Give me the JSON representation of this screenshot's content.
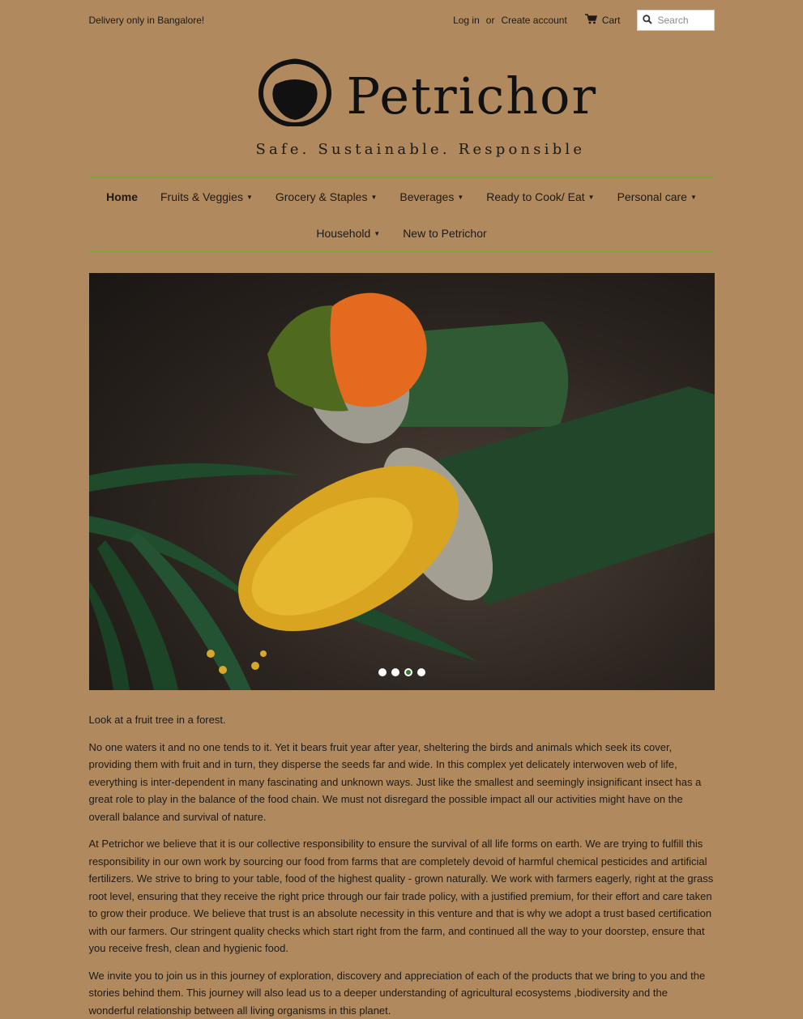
{
  "topbar": {
    "delivery_note": "Delivery only in Bangalore!",
    "login": "Log in",
    "or": "or",
    "create_account": "Create account",
    "cart": "Cart",
    "search_placeholder": "Search"
  },
  "brand": {
    "name": "Petrichor",
    "tagline": "Safe. Sustainable. Responsible"
  },
  "nav": {
    "row1": [
      {
        "label": "Home",
        "active": true,
        "dropdown": false
      },
      {
        "label": "Fruits & Veggies",
        "dropdown": true
      },
      {
        "label": "Grocery & Staples",
        "dropdown": true
      },
      {
        "label": "Beverages",
        "dropdown": true
      },
      {
        "label": "Ready to Cook/ Eat",
        "dropdown": true
      },
      {
        "label": "Personal care",
        "dropdown": true
      }
    ],
    "row2": [
      {
        "label": "Household",
        "dropdown": true
      },
      {
        "label": "New to Petrichor",
        "dropdown": false
      }
    ],
    "caret": "▼"
  },
  "slideshow": {
    "slide_count": 4,
    "active_index": 2
  },
  "content": {
    "p1": "Look at a fruit tree in a forest.",
    "p2": "No one waters it and no one tends to it. Yet it bears fruit year after year, sheltering the birds and animals which seek its cover, providing them with fruit and in turn, they disperse the seeds far and wide. In this complex yet delicately interwoven web of life, everything is inter-dependent in many fascinating and unknown ways.  Just like the smallest and seemingly insignificant insect has a great role to play in the balance of the food chain. We must not disregard the possible impact all our activities might have on the overall balance and survival of nature.",
    "p3": "At Petrichor we believe that it is our collective responsibility to ensure the survival of all life forms on earth. We are trying to fulfill this responsibility in our own work by sourcing our food from farms that are completely devoid of harmful chemical pesticides and artificial fertilizers.  We strive to bring to your table, food of the highest quality - grown naturally. We work with farmers eagerly, right at the grass root level, ensuring that they receive the right price through our fair trade policy, with a justified premium, for their effort and care taken to grow their produce. We believe that trust is an absolute necessity in this venture and that is why we adopt a trust based certification with our farmers. Our stringent quality checks which start right from the farm, and continued all the way to your doorstep, ensure that you receive fresh, clean and hygienic food.",
    "p4": "We invite you to join us in this journey of exploration, discovery and appreciation of each of the products that we bring to you and the stories behind them. This journey will also lead us to a deeper understanding of agricultural ecosystems ,biodiversity and the wonderful relationship between all living organisms in this planet."
  },
  "colors": {
    "background": "#b08a5e",
    "nav_rule": "#7aa833",
    "active_dot": "#2d7a2d"
  }
}
